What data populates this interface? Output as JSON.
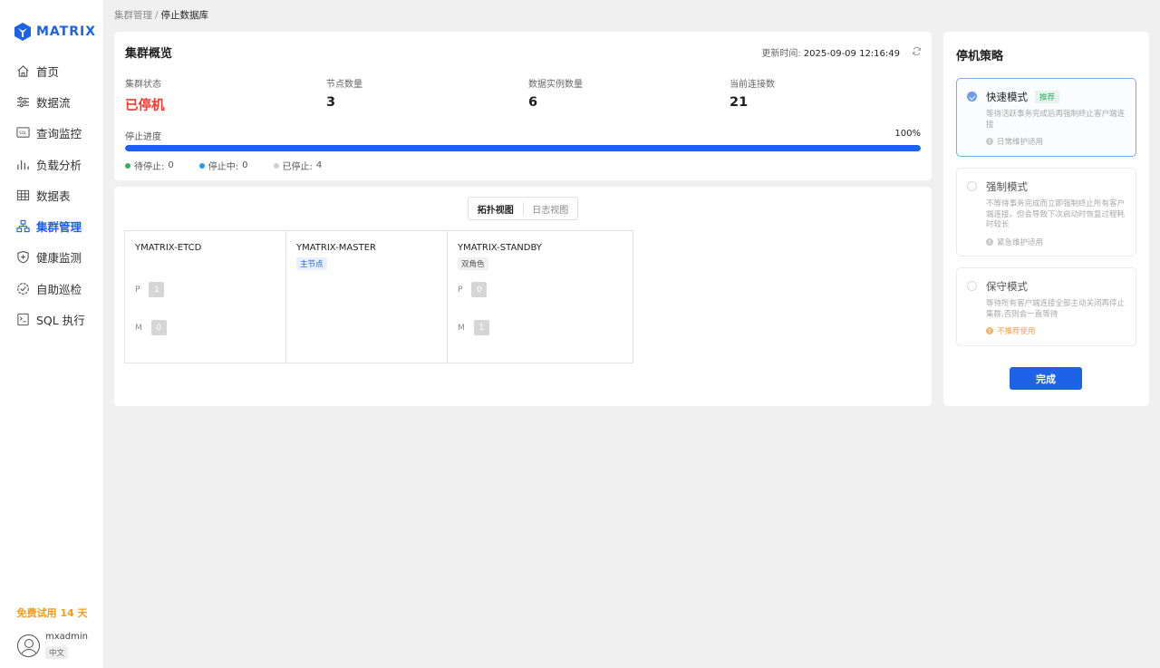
{
  "app": {
    "logo_text": "MATRIX"
  },
  "sidebar": {
    "items": [
      {
        "label": "首页",
        "icon": "home-icon"
      },
      {
        "label": "数据流",
        "icon": "data-flow-icon"
      },
      {
        "label": "查询监控",
        "icon": "sql-monitor-icon"
      },
      {
        "label": "负载分析",
        "icon": "bar-chart-icon"
      },
      {
        "label": "数据表",
        "icon": "table-icon"
      },
      {
        "label": "集群管理",
        "icon": "cluster-icon",
        "active": true
      },
      {
        "label": "健康监测",
        "icon": "shield-icon"
      },
      {
        "label": "自助巡检",
        "icon": "inspection-icon"
      },
      {
        "label": "SQL 执行",
        "icon": "sql-exec-icon"
      }
    ],
    "trial": "免费试用 14 天",
    "user": {
      "name": "mxadmin",
      "lang": "中文"
    }
  },
  "breadcrumb": {
    "parent": "集群管理",
    "separator": "/",
    "current": "停止数据库"
  },
  "overview": {
    "title": "集群概览",
    "update_label": "更新时间:",
    "update_time": "2025-09-09 12:16:49",
    "stats": [
      {
        "label": "集群状态",
        "value": "已停机"
      },
      {
        "label": "节点数量",
        "value": "3"
      },
      {
        "label": "数据实例数量",
        "value": "6"
      },
      {
        "label": "当前连接数",
        "value": "21"
      }
    ],
    "progress_label": "停止进度",
    "progress_percent": 100,
    "progress_text": "100%",
    "legend": [
      {
        "label": "待停止:",
        "count": "0",
        "color": "#2fb35a"
      },
      {
        "label": "停止中:",
        "count": "0",
        "color": "#1aa0ef"
      },
      {
        "label": "已停止:",
        "count": "4",
        "color": "#d0d0d0"
      }
    ]
  },
  "topology": {
    "tabs": [
      "拓扑视图",
      "日志视图"
    ],
    "nodes": [
      {
        "name": "YMATRIX-ETCD",
        "tag": "",
        "slots": [
          {
            "label": "P",
            "value": "1"
          },
          {
            "label": "M",
            "value": "0"
          }
        ]
      },
      {
        "name": "YMATRIX-MASTER",
        "tag": "主节点",
        "slots": []
      },
      {
        "name": "YMATRIX-STANDBY",
        "tag": "双角色",
        "slots": [
          {
            "label": "P",
            "value": "0"
          },
          {
            "label": "M",
            "value": "1"
          }
        ]
      }
    ]
  },
  "strategy": {
    "title": "停机策略",
    "options": [
      {
        "name": "快速模式",
        "badge": "推荐",
        "desc": "等待活跃事务完成后再强制终止客户端连接",
        "note": "日常维护适用",
        "selected": true
      },
      {
        "name": "强制模式",
        "badge": "",
        "desc": "不等待事务完成而立即强制终止所有客户端连接。但会导致下次启动时恢复过程耗时较长",
        "note": "紧急维护适用",
        "selected": false
      },
      {
        "name": "保守模式",
        "badge": "",
        "desc": "等待所有客户端连接全部主动关闭再停止集群,否则会一直等待",
        "note": "不推荐使用",
        "selected": false
      }
    ],
    "done_label": "完成"
  },
  "colors": {
    "accent": "#1c63e8",
    "danger": "#f03a2e",
    "trial": "#f59b1b"
  }
}
